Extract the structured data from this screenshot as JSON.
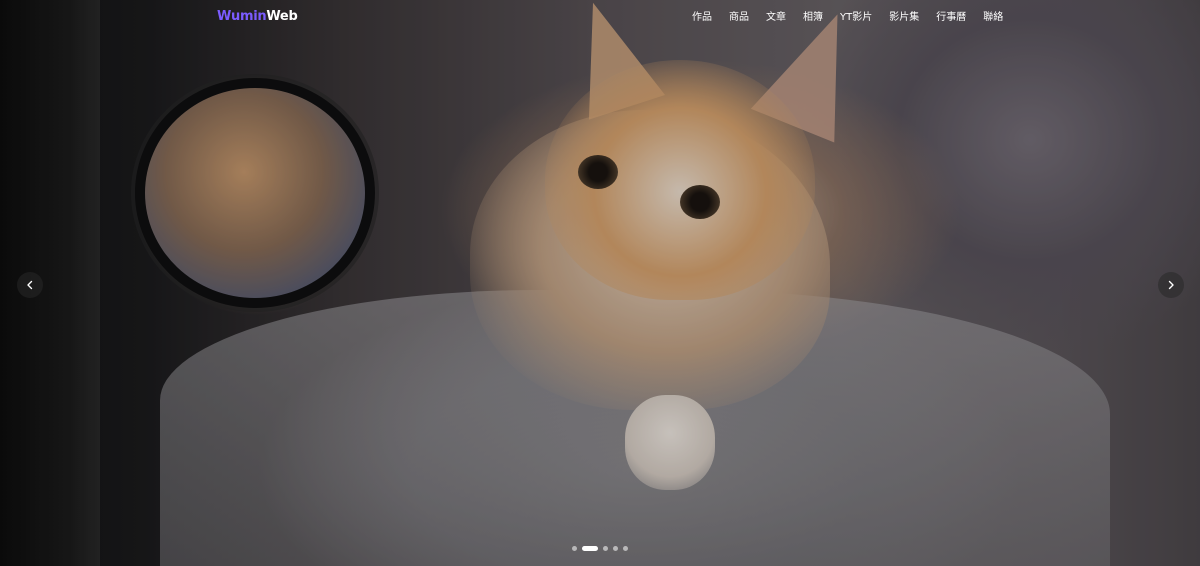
{
  "header": {
    "logo_part1": "Wumin",
    "logo_part2": "Web"
  },
  "nav": {
    "items": [
      {
        "label": "作品"
      },
      {
        "label": "商品"
      },
      {
        "label": "文章"
      },
      {
        "label": "相簿"
      },
      {
        "label": "YT影片"
      },
      {
        "label": "影片集"
      },
      {
        "label": "行事曆"
      },
      {
        "label": "聯絡"
      }
    ]
  },
  "carousel": {
    "slide_count": 5,
    "active_index": 1,
    "prev_icon": "chevron-left-icon",
    "next_icon": "chevron-right-icon"
  },
  "colors": {
    "logo_accent": "#7b5cff",
    "nav_text": "#ffffff",
    "dot_active": "#ffffff"
  }
}
